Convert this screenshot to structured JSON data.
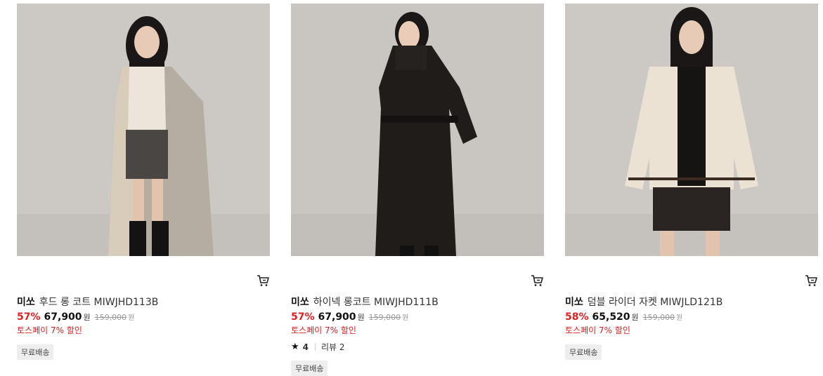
{
  "products": [
    {
      "brand": "미쏘",
      "name": "후드 롱 코트 MIWJHD113B",
      "discount": "57%",
      "price": "67,900",
      "currency": "원",
      "original_price": "159,000",
      "original_currency": "원",
      "promo": "토스페이 7% 할인",
      "badge": "무료배송",
      "image_alt": "model wearing long grey hooded coat",
      "coat_color": "#b7afa4"
    },
    {
      "brand": "미쏘",
      "name": "하이넥 롱코트 MIWJHD111B",
      "discount": "57%",
      "price": "67,900",
      "currency": "원",
      "original_price": "159,000",
      "original_currency": "원",
      "promo": "토스페이 7% 할인",
      "rating": "4",
      "review_label": "리뷰 2",
      "badge": "무료배송",
      "image_alt": "model wearing black high neck long coat",
      "coat_color": "#1e1b19"
    },
    {
      "brand": "미쏘",
      "name": "덤블 라이더 자켓 MIWJLD121B",
      "discount": "58%",
      "price": "65,520",
      "currency": "원",
      "original_price": "159,000",
      "original_currency": "원",
      "promo": "토스페이 7% 할인",
      "badge": "무료배송",
      "image_alt": "model wearing ivory fleece rider jacket",
      "coat_color": "#ece3d6"
    }
  ],
  "icons": {
    "cart": "cart-icon",
    "star": "star-icon"
  },
  "colors": {
    "discount": "#e02020",
    "badge_bg": "#eeeeee",
    "photo_bg": "#c9c5c0"
  }
}
